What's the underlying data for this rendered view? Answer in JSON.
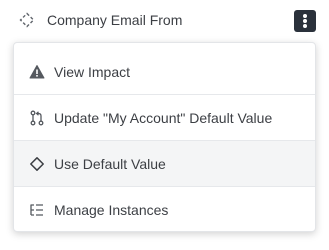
{
  "header": {
    "field_label": "Company Email From",
    "field_icon": "dashed-diamond-icon",
    "more_icon": "kebab-menu-icon"
  },
  "menu": {
    "items": [
      {
        "label": "View Impact",
        "icon": "warning-triangle-icon"
      },
      {
        "label": "Update \"My Account\" Default Value",
        "icon": "git-pull-request-icon"
      },
      {
        "label": "Use Default Value",
        "icon": "diamond-icon",
        "highlighted": true
      },
      {
        "label": "Manage Instances",
        "icon": "list-tree-icon"
      }
    ]
  },
  "colors": {
    "menu_background": "#ffffff",
    "highlight_background": "#f4f5f6",
    "kebab_background": "#2a313b",
    "text": "#3c3f44"
  }
}
